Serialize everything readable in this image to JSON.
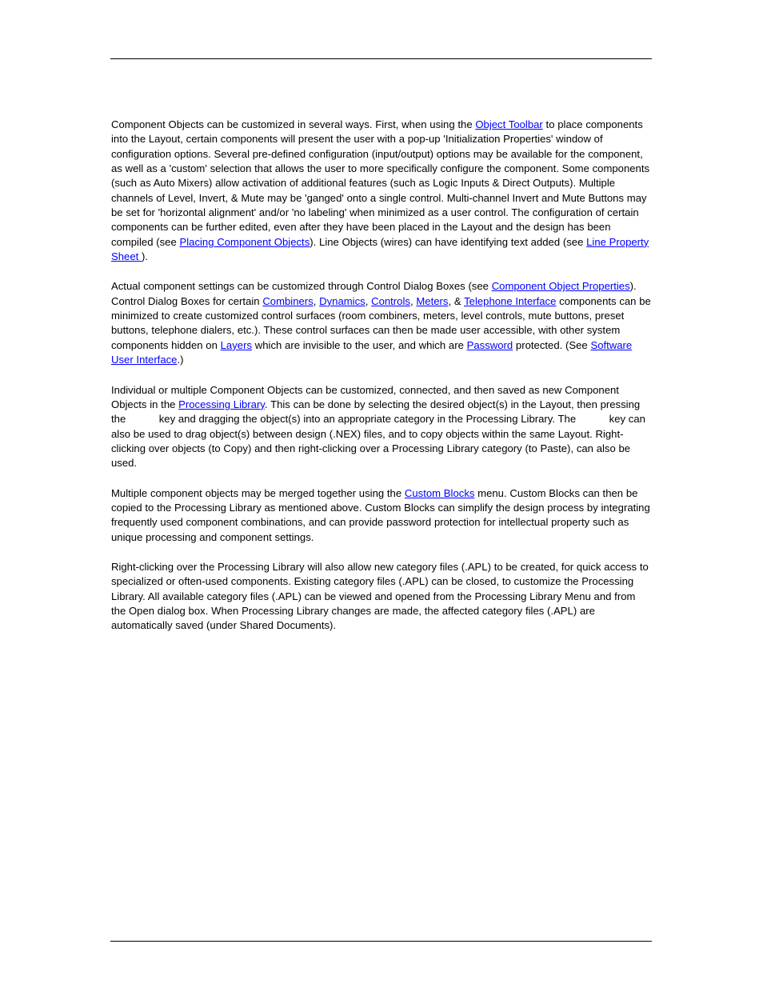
{
  "document": {
    "link_color": "#0000ff",
    "text_color": "#000000",
    "background_color": "#ffffff",
    "header_rule": "horizontal-rule",
    "footer_rule": "horizontal-rule"
  },
  "paragraphs": {
    "p1": {
      "s1": "Component Objects can be customized in several ways. First, when using the ",
      "link1": "Object Toolbar",
      "s2": " to place components into the Layout, certain components will present the user with a pop-up 'Initialization Properties' window of configuration options. Several pre-defined configuration (input/output) options may be available for the component, as well as a 'custom' selection that allows the user to more specifically configure the component. Some components (such as Auto Mixers) allow activation of additional features (such as Logic Inputs & Direct Outputs). Multiple channels of Level, Invert, & Mute may be 'ganged' onto a single control. Multi-channel Invert and Mute Buttons may be set for 'horizontal alignment' and/or 'no labeling' when minimized as a user control. The configuration of certain components can be further edited, even after they have been placed in the Layout and the design has been compiled (see ",
      "link2": "Placing Component Objects",
      "s3": "). Line Objects (wires) can have identifying text added (see ",
      "link3": "Line Property Sheet ",
      "s4": ")."
    },
    "p2": {
      "s1": "Actual component settings can be customized through Control Dialog Boxes (see ",
      "link1": "Component Object Properties",
      "s2": "). Control Dialog Boxes for certain ",
      "link2": "Combiners",
      "s3": ", ",
      "link3": "Dynamics",
      "s4": ", ",
      "link4": "Controls",
      "s5": ", ",
      "link5": "Meters",
      "s6": ", & ",
      "link6": "Telephone Interface",
      "s7": " components can be minimized to create customized control surfaces (room combiners, meters, level controls, mute buttons, preset buttons, telephone dialers, etc.). These control surfaces can then be made user accessible, with other system components hidden on ",
      "link7": "Layers",
      "s8": " which are invisible to the user, and which are ",
      "link8": "Password",
      "s9": " protected. (See ",
      "link9": "Software User Interface",
      "s10": ".)"
    },
    "p3": {
      "s1": "Individual or multiple Component Objects can be customized, connected, and then saved as new Component Objects in the ",
      "link1": "Processing Library",
      "s2": ". This can be done by selecting the desired object(s) in the Layout, then pressing the ",
      "s3": " key and dragging the object(s) into an appropriate category in the Processing Library. The ",
      "s4": " key can also be used to drag object(s) between design (.NEX) files, and to copy objects within the same Layout. Right-clicking over objects (to Copy) and then right-clicking over a Processing Library category (to Paste), can also be used."
    },
    "p4": {
      "s1": "Multiple component objects may be merged together using the ",
      "link1": "Custom Blocks",
      "s2": " menu. Custom Blocks can then be copied to the Processing Library as mentioned above. Custom Blocks can simplify the design process by integrating frequently used component combinations, and can provide password protection for intellectual property such as unique processing and component settings."
    },
    "p5": {
      "s1": "Right-clicking over the Processing Library will also allow new category files (.APL) to be created, for quick access to specialized or often-used components. Existing category files (.APL) can be closed, to customize the Processing Library. All available category files (.APL) can be viewed and opened from the Processing Library Menu and from the Open dialog box. When Processing Library changes are made, the affected category files (.APL) are automatically saved (under Shared Documents)."
    }
  }
}
